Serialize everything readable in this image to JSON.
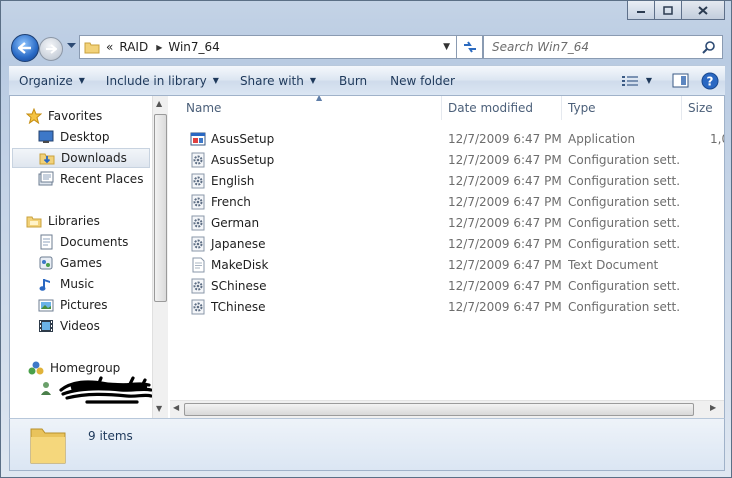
{
  "address": {
    "overflow": "«",
    "crumbs": [
      "RAID",
      "Win7_64"
    ]
  },
  "search": {
    "placeholder": "Search Win7_64"
  },
  "toolbar": {
    "organize": "Organize",
    "include_in_library": "Include in library",
    "share_with": "Share with",
    "burn": "Burn",
    "new_folder": "New folder"
  },
  "nav": {
    "favorites": "Favorites",
    "desktop": "Desktop",
    "downloads": "Downloads",
    "recent_places": "Recent Places",
    "libraries": "Libraries",
    "documents": "Documents",
    "games": "Games",
    "music": "Music",
    "pictures": "Pictures",
    "videos": "Videos",
    "homegroup": "Homegroup"
  },
  "columns": {
    "name": "Name",
    "date_modified": "Date modified",
    "type": "Type",
    "size": "Size"
  },
  "files": [
    {
      "name": "AsusSetup",
      "date": "12/7/2009 6:47 PM",
      "type": "Application",
      "size": "1,0",
      "icon": "application-icon"
    },
    {
      "name": "AsusSetup",
      "date": "12/7/2009 6:47 PM",
      "type": "Configuration sett...",
      "size": "",
      "icon": "config-file-icon"
    },
    {
      "name": "English",
      "date": "12/7/2009 6:47 PM",
      "type": "Configuration sett...",
      "size": "",
      "icon": "config-file-icon"
    },
    {
      "name": "French",
      "date": "12/7/2009 6:47 PM",
      "type": "Configuration sett...",
      "size": "",
      "icon": "config-file-icon"
    },
    {
      "name": "German",
      "date": "12/7/2009 6:47 PM",
      "type": "Configuration sett...",
      "size": "",
      "icon": "config-file-icon"
    },
    {
      "name": "Japanese",
      "date": "12/7/2009 6:47 PM",
      "type": "Configuration sett...",
      "size": "",
      "icon": "config-file-icon"
    },
    {
      "name": "MakeDisk",
      "date": "12/7/2009 6:47 PM",
      "type": "Text Document",
      "size": "",
      "icon": "text-file-icon"
    },
    {
      "name": "SChinese",
      "date": "12/7/2009 6:47 PM",
      "type": "Configuration sett...",
      "size": "",
      "icon": "config-file-icon"
    },
    {
      "name": "TChinese",
      "date": "12/7/2009 6:47 PM",
      "type": "Configuration sett...",
      "size": "",
      "icon": "config-file-icon"
    }
  ],
  "status": {
    "count": "9 items"
  },
  "colors": {
    "toolbar_text": "#1e395b",
    "header_text": "#4c607a",
    "dim_text": "#6d6d6d"
  }
}
